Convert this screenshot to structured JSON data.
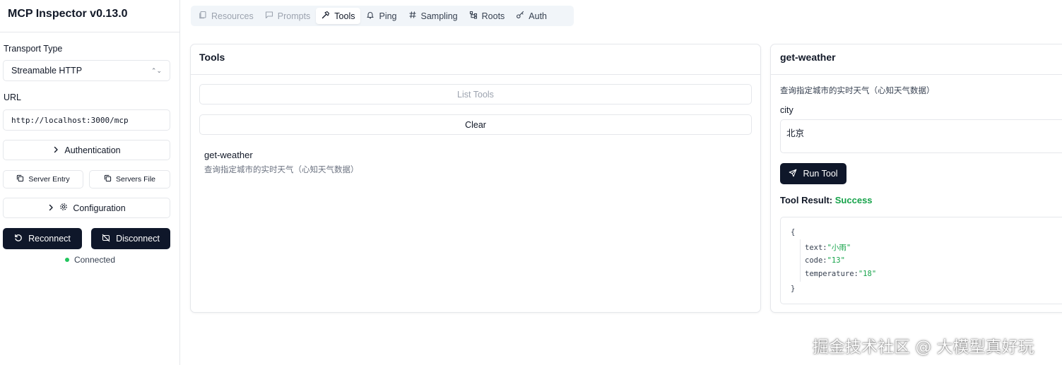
{
  "app": {
    "title": "MCP Inspector v0.13.0"
  },
  "sidebar": {
    "transport_label": "Transport Type",
    "transport_value": "Streamable HTTP",
    "url_label": "URL",
    "url_value": "http://localhost:3000/mcp",
    "authentication_label": "Authentication",
    "server_entry_label": "Server Entry",
    "servers_file_label": "Servers File",
    "configuration_label": "Configuration",
    "reconnect_label": "Reconnect",
    "disconnect_label": "Disconnect",
    "status_text": "Connected",
    "status_color": "#22c55e"
  },
  "tabs": [
    {
      "label": "Resources",
      "icon": "files-icon",
      "state": "disabled"
    },
    {
      "label": "Prompts",
      "icon": "message-icon",
      "state": "disabled"
    },
    {
      "label": "Tools",
      "icon": "hammer-icon",
      "state": "active"
    },
    {
      "label": "Ping",
      "icon": "bell-icon",
      "state": "normal"
    },
    {
      "label": "Sampling",
      "icon": "hash-icon",
      "state": "normal"
    },
    {
      "label": "Roots",
      "icon": "tree-icon",
      "state": "normal"
    },
    {
      "label": "Auth",
      "icon": "key-icon",
      "state": "normal"
    }
  ],
  "tools_panel": {
    "title": "Tools",
    "list_tools_label": "List Tools",
    "clear_label": "Clear",
    "items": [
      {
        "name": "get-weather",
        "description": "查询指定城市的实时天气（心知天气数据）"
      }
    ]
  },
  "detail_panel": {
    "title": "get-weather",
    "description": "查询指定城市的实时天气（心知天气数据）",
    "param_label": "city",
    "param_value": "北京",
    "run_label": "Run Tool",
    "result_label": "Tool Result:",
    "result_status": "Success",
    "result_status_color": "#16a34a",
    "result_json": {
      "open": "{",
      "close": "}",
      "entries": [
        {
          "key": "text:",
          "value": "\"小雨\""
        },
        {
          "key": "code:",
          "value": "\"13\""
        },
        {
          "key": "temperature:",
          "value": "\"18\""
        }
      ]
    }
  },
  "watermark": "掘金技术社区 @ 大模型真好玩"
}
